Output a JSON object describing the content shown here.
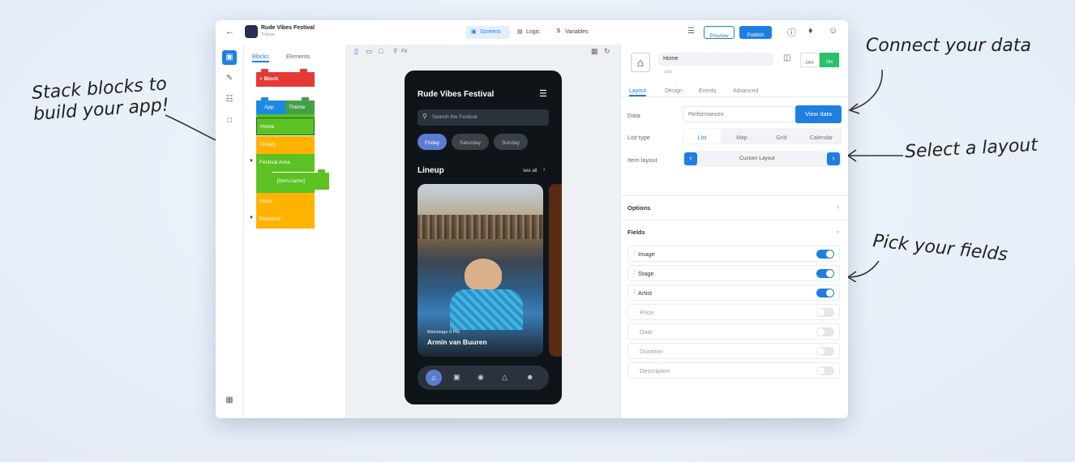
{
  "annotations": {
    "stack_blocks": "Stack blocks to build your app!",
    "connect_data": "Connect your data",
    "select_layout": "Select a layout",
    "pick_fields": "Pick your fields"
  },
  "topbar": {
    "app_name": "Rude Vibes Festival",
    "app_sub": "Tribute",
    "tabs": [
      {
        "label": "Screens",
        "active": true
      },
      {
        "label": "Logic",
        "active": false
      },
      {
        "label": "Variables",
        "active": false
      }
    ],
    "preview_label": "Preview",
    "publish_label": "Publish"
  },
  "blocks_panel": {
    "tabs": [
      {
        "label": "Blocks",
        "active": true
      },
      {
        "label": "Elements",
        "active": false
      }
    ],
    "add_block_label": "+ Block",
    "blocks": [
      {
        "label": "App",
        "color": "#1e88e5"
      },
      {
        "label": "Theme",
        "color": "#43a047"
      },
      {
        "label": "Home",
        "color": "#5cc122"
      },
      {
        "label": "Tickets",
        "color": "#ffb300"
      },
      {
        "label": "Festival Area",
        "color": "#5cc122"
      },
      {
        "label": "[item.name]",
        "color": "#5cc122"
      },
      {
        "label": "Store",
        "color": "#ffb300"
      },
      {
        "label": "Personal",
        "color": "#ffb300"
      }
    ]
  },
  "canvas": {
    "zoom_label": "Fit"
  },
  "phone": {
    "title": "Rude Vibes Festival",
    "search_placeholder": "Search the Festival",
    "days": [
      {
        "label": "Friday",
        "active": true
      },
      {
        "label": "Saturday",
        "active": false
      },
      {
        "label": "Sunday",
        "active": false
      }
    ],
    "section_title": "Lineup",
    "see_all": "see all",
    "card_stage": "Mainstage 9 PM",
    "card_artist": "Armin van Buuren"
  },
  "props": {
    "component_name": "Home",
    "component_type": "List",
    "off_label": "OFF",
    "on_label": "ON",
    "tabs": [
      {
        "label": "Layout",
        "active": true
      },
      {
        "label": "Design",
        "active": false
      },
      {
        "label": "Events",
        "active": false
      },
      {
        "label": "Advanced",
        "active": false
      }
    ],
    "data_label": "Data",
    "data_value": "Performances",
    "view_data_label": "View data",
    "list_type_label": "List type",
    "list_types": [
      {
        "label": "List",
        "active": true
      },
      {
        "label": "Map",
        "active": false
      },
      {
        "label": "Grid",
        "active": false
      },
      {
        "label": "Calendar",
        "active": false
      }
    ],
    "item_layout_label": "Item layout",
    "item_layout_value": "Custom Layout",
    "options_label": "Options",
    "fields_label": "Fields",
    "fields": [
      {
        "label": "Image",
        "on": true
      },
      {
        "label": "Stage",
        "on": true
      },
      {
        "label": "Artist",
        "on": true
      },
      {
        "label": "Price",
        "on": false
      },
      {
        "label": "Date",
        "on": false
      },
      {
        "label": "Duration",
        "on": false
      },
      {
        "label": "Description",
        "on": false
      }
    ]
  },
  "colors": {
    "accent": "#1e7fe0",
    "on_green": "#27c26a",
    "block_red": "#e53935"
  }
}
